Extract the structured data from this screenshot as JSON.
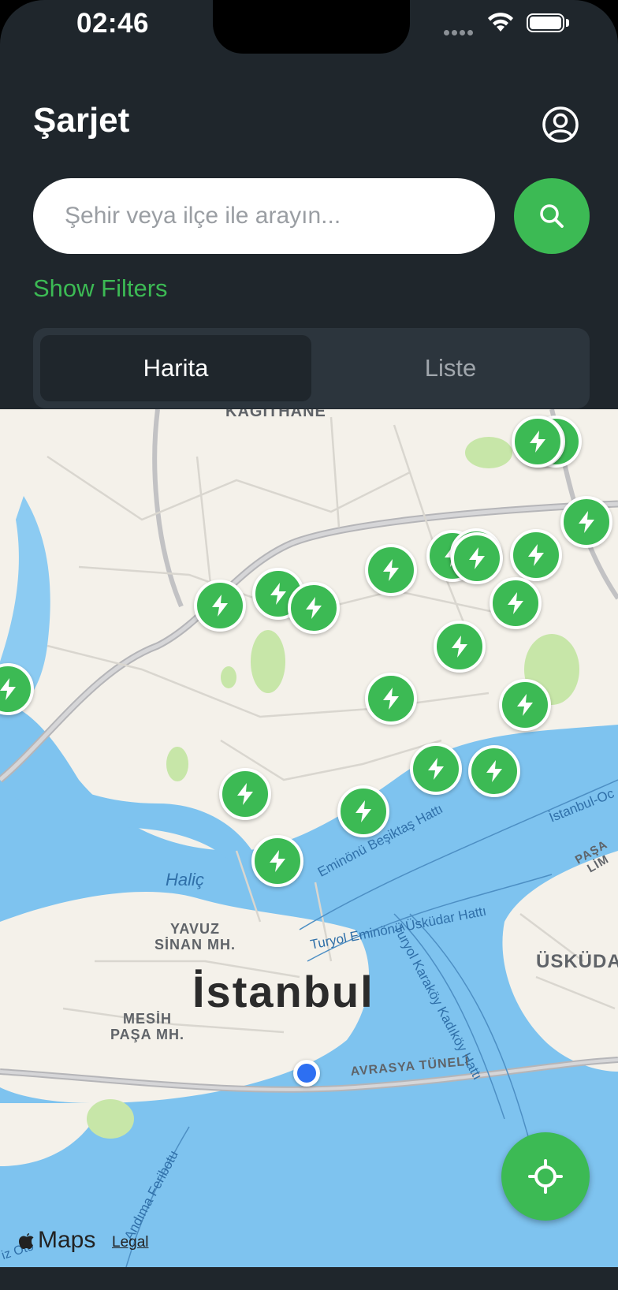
{
  "status_bar": {
    "time": "02:46"
  },
  "header": {
    "title": "Şarjet"
  },
  "search": {
    "placeholder": "Şehir veya ilçe ile arayın..."
  },
  "filters": {
    "label": "Show Filters"
  },
  "view_toggle": {
    "selected": "Harita",
    "options": [
      "Harita",
      "Liste"
    ]
  },
  "map": {
    "labels": {
      "kagithane": "KAĞITHANE",
      "istanbul": "İstanbul",
      "yavuz_sinan": "YAVUZ\nSİNAN MH.",
      "mesih_pasa": "MESİH\nPAŞA MH.",
      "uskudar": "ÜSKÜDA",
      "halic": "Haliç",
      "ferry_1": "Eminönü Beşiktaş Hattı",
      "ferry_2": "Turyol Eminönü Üsküdar Hattı",
      "ferry_3": "Turyol Karaköy Kadıköy Hattı",
      "ferry_4": "İstanbul-Oc",
      "ferry_5": "Andıma Feribotu",
      "avrasya": "AVRASYA TÜNELİ",
      "pasa_limani": "PAŞA LİM",
      "oto": "iz Oto"
    },
    "attribution": {
      "logo": "Maps",
      "legal": "Legal"
    },
    "station_count": 22
  },
  "colors": {
    "accent": "#3cba54",
    "header_bg": "#1f262c",
    "user_location": "#2d6ff2"
  },
  "icons": [
    "wifi-icon",
    "battery-icon",
    "profile-icon",
    "search-icon",
    "bolt-icon",
    "locate-icon",
    "apple-logo-icon"
  ]
}
